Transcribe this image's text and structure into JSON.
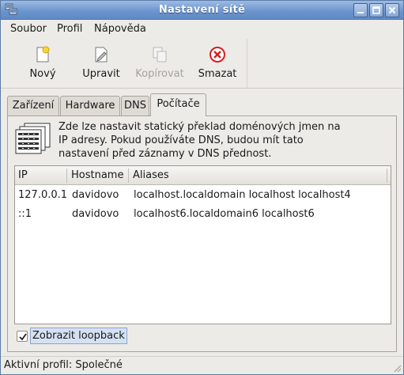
{
  "window": {
    "title": "Nastavení sítě",
    "icons": {
      "app": "network-icon",
      "minimize": "minimize-icon",
      "maximize": "maximize-icon",
      "close": "close-icon"
    }
  },
  "menu": {
    "items": [
      {
        "label": "Soubor"
      },
      {
        "label": "Profil"
      },
      {
        "label": "Nápověda"
      }
    ]
  },
  "toolbar": {
    "items": [
      {
        "label": "Nový",
        "icon": "new-document-icon",
        "enabled": true
      },
      {
        "label": "Upravit",
        "icon": "edit-icon",
        "enabled": true
      },
      {
        "label": "Kopírovat",
        "icon": "copy-icon",
        "enabled": false
      },
      {
        "label": "Smazat",
        "icon": "delete-icon",
        "enabled": true
      }
    ]
  },
  "tabs": [
    {
      "label": "Zařízení",
      "active": false
    },
    {
      "label": "Hardware",
      "active": false
    },
    {
      "label": "DNS",
      "active": false
    },
    {
      "label": "Počítače",
      "active": true
    }
  ],
  "hosts": {
    "info_text": "Zde lze nastavit statický překlad doménových jmen na IP adresy. Pokud používáte DNS, budou mít tato nastavení před záznamy v DNS přednost.",
    "columns": [
      "IP",
      "Hostname",
      "Aliases"
    ],
    "rows": [
      {
        "ip": "127.0.0.1",
        "hostname": "davidovo",
        "aliases": "localhost.localdomain localhost localhost4"
      },
      {
        "ip": "::1",
        "hostname": "davidovo",
        "aliases": "localhost6.localdomain6 localhost6"
      }
    ],
    "loopback": {
      "label": "Zobrazit loopback",
      "checked": true
    }
  },
  "status": {
    "text": "Aktivní profil: Společné"
  },
  "colors": {
    "titlebar": "#6d96cf",
    "delete_red": "#d42020"
  }
}
